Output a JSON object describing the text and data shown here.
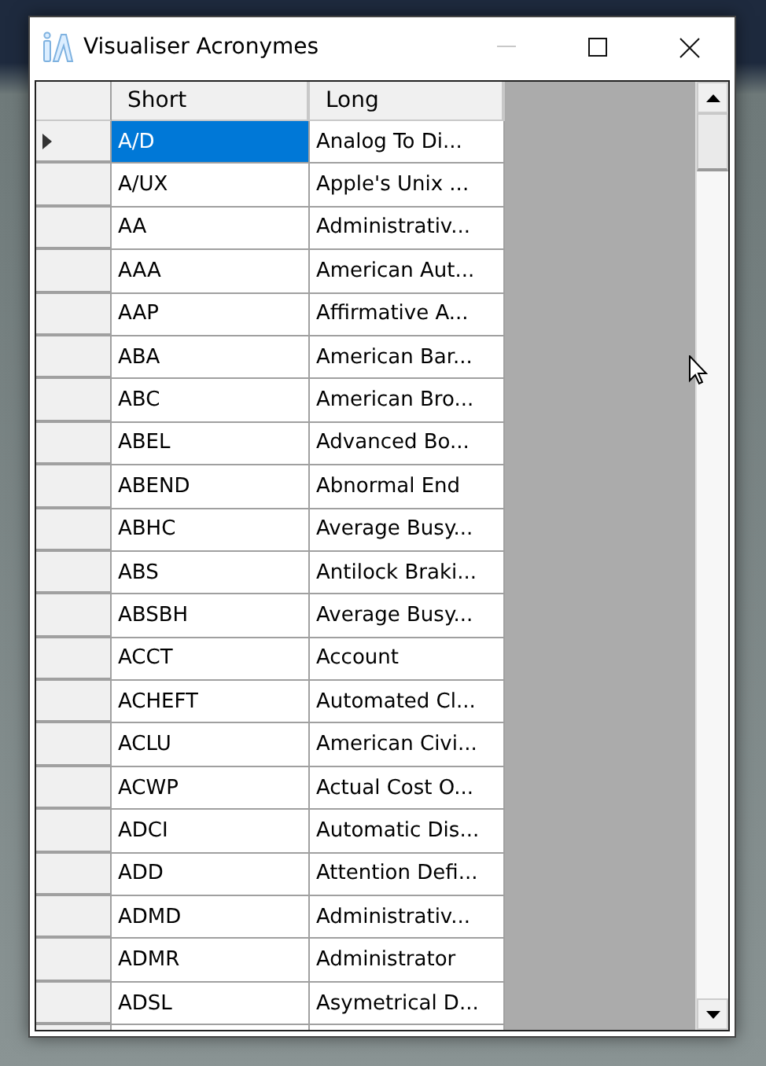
{
  "window": {
    "title": "Visualiser Acronymes",
    "controls": [
      {
        "kind": "minimize",
        "disabled": true
      },
      {
        "kind": "maximize",
        "disabled": false
      },
      {
        "kind": "close",
        "disabled": false
      }
    ]
  },
  "table": {
    "columns": [
      "Short",
      "Long"
    ],
    "rows": [
      {
        "short": "A/D",
        "long": "Analog To Di...",
        "selected": true
      },
      {
        "short": "A/UX",
        "long": "Apple's Unix ...",
        "selected": false
      },
      {
        "short": "AA",
        "long": "Administrativ...",
        "selected": false
      },
      {
        "short": "AAA",
        "long": "American Aut...",
        "selected": false
      },
      {
        "short": "AAP",
        "long": "Affirmative A...",
        "selected": false
      },
      {
        "short": "ABA",
        "long": "American Bar...",
        "selected": false
      },
      {
        "short": "ABC",
        "long": "American Bro...",
        "selected": false
      },
      {
        "short": "ABEL",
        "long": "Advanced Bo...",
        "selected": false
      },
      {
        "short": "ABEND",
        "long": "Abnormal End",
        "selected": false
      },
      {
        "short": "ABHC",
        "long": "Average Busy...",
        "selected": false
      },
      {
        "short": "ABS",
        "long": "Antilock Braki...",
        "selected": false
      },
      {
        "short": "ABSBH",
        "long": "Average Busy...",
        "selected": false
      },
      {
        "short": "ACCT",
        "long": "Account",
        "selected": false
      },
      {
        "short": "ACHEFT",
        "long": "Automated Cl...",
        "selected": false
      },
      {
        "short": "ACLU",
        "long": "American Civi...",
        "selected": false
      },
      {
        "short": "ACWP",
        "long": "Actual Cost O...",
        "selected": false
      },
      {
        "short": "ADCI",
        "long": "Automatic Dis...",
        "selected": false
      },
      {
        "short": "ADD",
        "long": "Attention Defi...",
        "selected": false
      },
      {
        "short": "ADMD",
        "long": "Administrativ...",
        "selected": false
      },
      {
        "short": "ADMR",
        "long": "Administrator",
        "selected": false
      },
      {
        "short": "ADSL",
        "long": "Asymetrical D...",
        "selected": false
      }
    ]
  }
}
